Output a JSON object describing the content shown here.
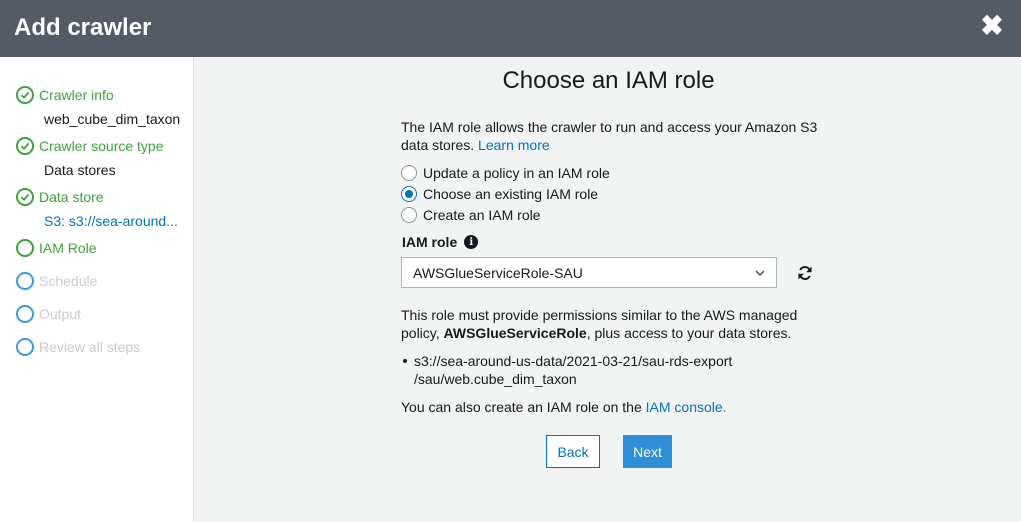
{
  "window": {
    "title": "Add crawler",
    "close_icon": "close-icon"
  },
  "sidebar": {
    "steps": [
      {
        "label": "Crawler info",
        "state": "done",
        "detail": "web_cube_dim_taxon"
      },
      {
        "label": "Crawler source type",
        "state": "done",
        "detail": "Data stores"
      },
      {
        "label": "Data store",
        "state": "done",
        "detail": "S3: s3://sea-around..."
      },
      {
        "label": "IAM Role",
        "state": "current"
      },
      {
        "label": "Schedule",
        "state": "future"
      },
      {
        "label": "Output",
        "state": "future"
      },
      {
        "label": "Review all steps",
        "state": "future"
      }
    ]
  },
  "main": {
    "heading": "Choose an IAM role",
    "intro_text": "The IAM role allows the crawler to run and access your Amazon S3 data stores.",
    "learn_more": "Learn more",
    "options": [
      {
        "label": "Update a policy in an IAM role",
        "checked": false
      },
      {
        "label": "Choose an existing IAM role",
        "checked": true
      },
      {
        "label": "Create an IAM role",
        "checked": false
      }
    ],
    "iam_role_label": "IAM role",
    "iam_role_value": "AWSGlueServiceRole-SAU",
    "desc_before": "This role must provide permissions similar to the AWS managed policy,",
    "desc_bold": "AWSGlueServiceRole",
    "desc_after": ", plus access to your data stores.",
    "path_line1": "s3://sea-around-us-data/2021-03-21/sau-rds-export",
    "path_line2": "/sau/web.cube_dim_taxon",
    "foot_text": "You can also create an IAM role on the",
    "foot_link": "IAM console.",
    "back_label": "Back",
    "next_label": "Next"
  },
  "colors": {
    "header_bg": "#545b64",
    "done_green": "#3fa03f",
    "link_blue": "#0073bb",
    "primary_button": "#2e8fd6"
  }
}
